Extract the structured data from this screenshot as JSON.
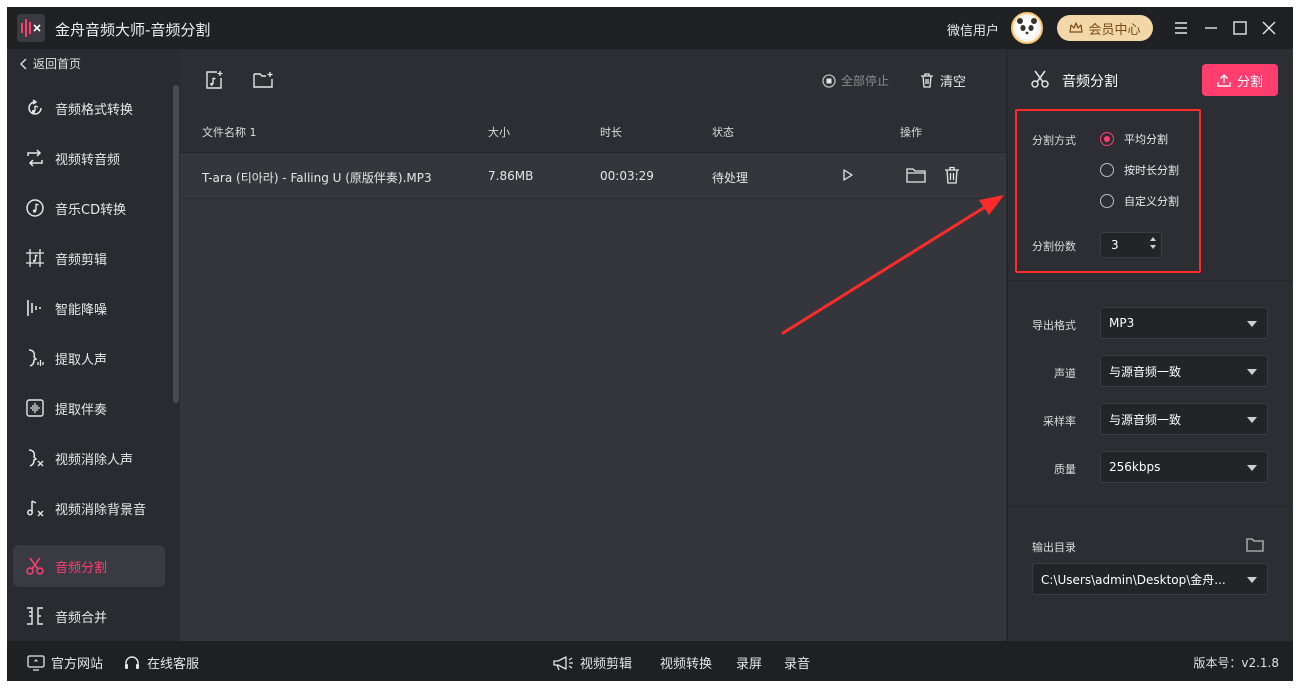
{
  "titlebar": {
    "app_title": "金舟音频大师-音频分割",
    "user_name": "微信用户",
    "vip_label": "会员中心"
  },
  "sidebar": {
    "back_label": "返回首页",
    "items": [
      {
        "label": "音频格式转换",
        "icon": "audio-convert-icon"
      },
      {
        "label": "视频转音频",
        "icon": "video-to-audio-icon"
      },
      {
        "label": "音乐CD转换",
        "icon": "cd-icon"
      },
      {
        "label": "音频剪辑",
        "icon": "audio-edit-icon"
      },
      {
        "label": "智能降噪",
        "icon": "denoise-icon"
      },
      {
        "label": "提取人声",
        "icon": "extract-vocal-icon"
      },
      {
        "label": "提取伴奏",
        "icon": "extract-accompaniment-icon"
      },
      {
        "label": "视频消除人声",
        "icon": "remove-vocal-icon"
      },
      {
        "label": "视频消除背景音",
        "icon": "remove-bgm-icon"
      },
      {
        "label": "音频分割",
        "icon": "scissors-icon",
        "active": true
      },
      {
        "label": "音频合并",
        "icon": "merge-icon"
      }
    ]
  },
  "toolbar": {
    "stop_all_label": "全部停止",
    "clear_label": "清空"
  },
  "table": {
    "columns": [
      "文件名称 1",
      "大小",
      "时长",
      "状态",
      "操作"
    ],
    "rows": [
      {
        "name": "T-ara (티아라) - Falling U (原版伴奏).MP3",
        "size": "7.86MB",
        "duration": "00:03:29",
        "status": "待处理"
      }
    ]
  },
  "panel": {
    "title": "音频分割",
    "split_button": "分割",
    "split_method_label": "分割方式",
    "split_options": [
      "平均分割",
      "按时长分割",
      "自定义分割"
    ],
    "selected_option": "平均分割",
    "parts_label": "分割份数",
    "parts_value": "3",
    "format_label": "导出格式",
    "format_value": "MP3",
    "channel_label": "声道",
    "channel_value": "与源音频一致",
    "sample_rate_label": "采样率",
    "sample_rate_value": "与源音频一致",
    "quality_label": "质量",
    "quality_value": "256kbps",
    "output_label": "输出目录",
    "output_path": "C:\\Users\\admin\\Desktop\\金舟..."
  },
  "bottombar": {
    "website": "官方网站",
    "support": "在线客服",
    "video_edit": "视频剪辑",
    "video_convert": "视频转换",
    "screen_record": "录屏",
    "audio_record": "录音",
    "version": "版本号：v2.1.8"
  },
  "colors": {
    "accent": "#ff3d6e",
    "highlight": "#ff2a2a",
    "vip": "#f2d7a8"
  }
}
